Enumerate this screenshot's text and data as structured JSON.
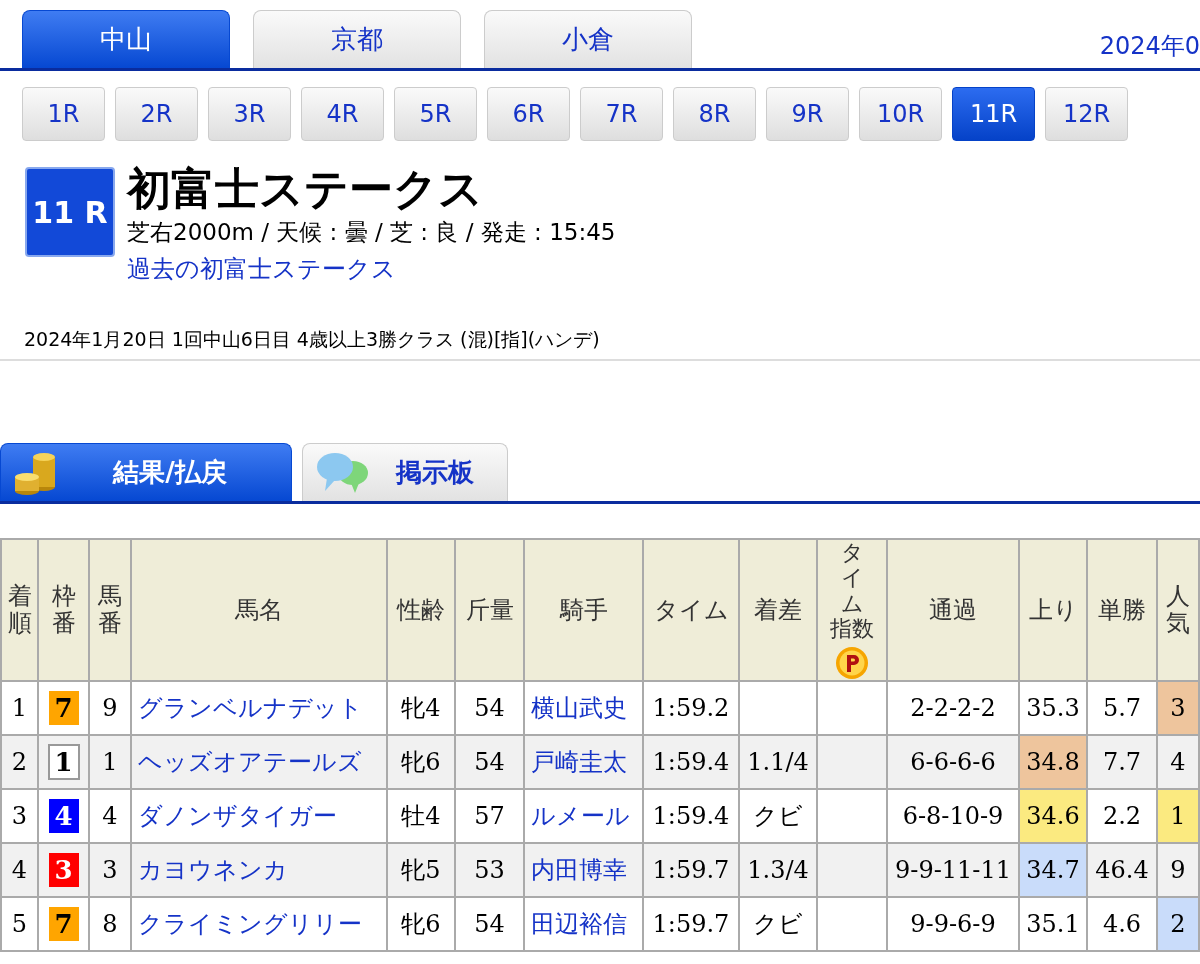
{
  "venue_tabs": [
    {
      "label": "中山",
      "selected": true
    },
    {
      "label": "京都",
      "selected": false
    },
    {
      "label": "小倉",
      "selected": false
    }
  ],
  "date_cut": "2024年0",
  "race_buttons": [
    {
      "label": "1R",
      "selected": false
    },
    {
      "label": "2R",
      "selected": false
    },
    {
      "label": "3R",
      "selected": false
    },
    {
      "label": "4R",
      "selected": false
    },
    {
      "label": "5R",
      "selected": false
    },
    {
      "label": "6R",
      "selected": false
    },
    {
      "label": "7R",
      "selected": false
    },
    {
      "label": "8R",
      "selected": false
    },
    {
      "label": "9R",
      "selected": false
    },
    {
      "label": "10R",
      "selected": false
    },
    {
      "label": "11R",
      "selected": true
    },
    {
      "label": "12R",
      "selected": false
    }
  ],
  "race": {
    "badge": "11 R",
    "title": "初富士ステークス",
    "info": "芝右2000m / 天候 : 曇 / 芝 : 良 / 発走 : 15:45",
    "past_link": "過去の初富士ステークス",
    "details": "2024年1月20日 1回中山6日目 4歳以上3勝クラス  (混)[指](ハンデ)"
  },
  "content_tabs": [
    {
      "label": "結果/払戻",
      "kind": "coins",
      "selected": true
    },
    {
      "label": "掲示板",
      "kind": "chat",
      "selected": false
    }
  ],
  "table": {
    "columns": [
      "着順",
      "枠番",
      "馬番",
      "馬名",
      "性齢",
      "斤量",
      "騎手",
      "タイム",
      "着差",
      "タイム指数",
      "通過",
      "上り",
      "単勝",
      "人気"
    ],
    "rows": [
      {
        "rank": "1",
        "bracket": {
          "text": "7",
          "color": "#ffa500"
        },
        "number": "9",
        "horse": "グランベルナデット",
        "sex_age": "牝4",
        "weight": "54",
        "jockey": "横山武史",
        "time": "1:59.2",
        "margin": "",
        "passing": "2-2-2-2",
        "last3f": {
          "text": "35.3"
        },
        "odds": "5.7",
        "popularity": {
          "text": "3",
          "color": "#eec59d"
        }
      },
      {
        "rank": "2",
        "bracket": {
          "text": "1",
          "color": "#ffffff"
        },
        "number": "1",
        "horse": "ヘッズオアテールズ",
        "sex_age": "牝6",
        "weight": "54",
        "jockey": "戸崎圭太",
        "time": "1:59.4",
        "margin": "1.1/4",
        "passing": "6-6-6-6",
        "last3f": {
          "text": "34.8",
          "color": "#eec59d"
        },
        "odds": "7.7",
        "popularity": {
          "text": "4"
        }
      },
      {
        "rank": "3",
        "bracket": {
          "text": "4",
          "color": "#0000ff"
        },
        "number": "4",
        "horse": "ダノンザタイガー",
        "sex_age": "牡4",
        "weight": "57",
        "jockey": "ルメール",
        "time": "1:59.4",
        "margin": "クビ",
        "passing": "6-8-10-9",
        "last3f": {
          "text": "34.6",
          "color": "#fbea80"
        },
        "odds": "2.2",
        "popularity": {
          "text": "1",
          "color": "#fbea80"
        }
      },
      {
        "rank": "4",
        "bracket": {
          "text": "3",
          "color": "#ff0000"
        },
        "number": "3",
        "horse": "カヨウネンカ",
        "sex_age": "牝5",
        "weight": "53",
        "jockey": "内田博幸",
        "time": "1:59.7",
        "margin": "1.3/4",
        "passing": "9-9-11-11",
        "last3f": {
          "text": "34.7",
          "color": "#c9dcfa"
        },
        "odds": "46.4",
        "popularity": {
          "text": "9"
        }
      },
      {
        "rank": "5",
        "bracket": {
          "text": "7",
          "color": "#ffa500"
        },
        "number": "8",
        "horse": "クライミングリリー",
        "sex_age": "牝6",
        "weight": "54",
        "jockey": "田辺裕信",
        "time": "1:59.7",
        "margin": "クビ",
        "passing": "9-9-6-9",
        "last3f": {
          "text": "35.1"
        },
        "odds": "4.6",
        "popularity": {
          "text": "2",
          "color": "#c9dcfa"
        }
      }
    ]
  }
}
